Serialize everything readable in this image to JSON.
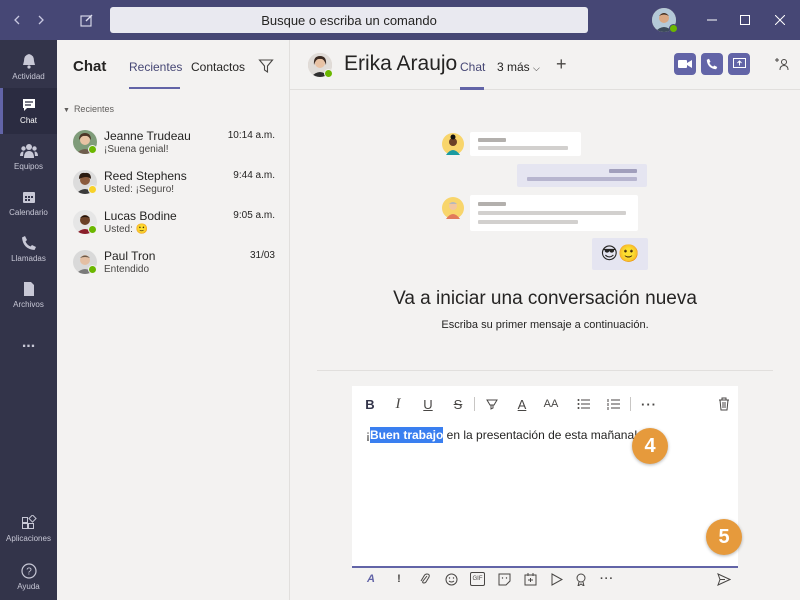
{
  "topbar": {
    "search_placeholder": "Busque o escriba un comando"
  },
  "rail": {
    "items": [
      {
        "label": "Actividad",
        "icon": "bell-icon"
      },
      {
        "label": "Chat",
        "icon": "chat-icon"
      },
      {
        "label": "Equipos",
        "icon": "teams-icon"
      },
      {
        "label": "Calendario",
        "icon": "calendar-icon"
      },
      {
        "label": "Llamadas",
        "icon": "phone-icon"
      },
      {
        "label": "Archivos",
        "icon": "files-icon"
      },
      {
        "label": "...",
        "icon": "more-icon"
      },
      {
        "label": "Aplicaciones",
        "icon": "apps-icon"
      },
      {
        "label": "Ayuda",
        "icon": "help-icon"
      }
    ]
  },
  "chatlist": {
    "title": "Chat",
    "tabs": [
      "Recientes",
      "Contactos"
    ],
    "section": "Recientes",
    "chats": [
      {
        "name": "Jeanne Trudeau",
        "time": "10:14 a.m.",
        "preview": "¡Suena genial!",
        "presence": "#6bb700"
      },
      {
        "name": "Reed Stephens",
        "time": "9:44 a.m.",
        "preview": "Usted: ¡Seguro!",
        "presence": "#f8d22a"
      },
      {
        "name": "Lucas Bodine",
        "time": "9:05 a.m.",
        "preview": "Usted: 🙂",
        "presence": "#6bb700"
      },
      {
        "name": "Paul Tron",
        "time": "31/03",
        "preview": "Entendido",
        "presence": "#6bb700"
      }
    ]
  },
  "main": {
    "contact_name": "Erika Araujo",
    "tab_chat": "Chat",
    "tab_more": "3 más",
    "empty_title": "Va a iniciar una conversación nueva",
    "empty_subtitle": "Escriba su primer mensaje a continuación.",
    "compose": {
      "prefix": "¡",
      "selected": "Buen trabajo",
      "rest": " en la presentación de esta mañana!"
    },
    "emoji": "😎🙂"
  },
  "callouts": {
    "step4": "4",
    "step5": "5"
  },
  "colors": {
    "accent": "#6264a7",
    "topbar": "#464775",
    "rail": "#33344a",
    "callout": "#e69a3c",
    "selection": "#3a7ff0"
  }
}
